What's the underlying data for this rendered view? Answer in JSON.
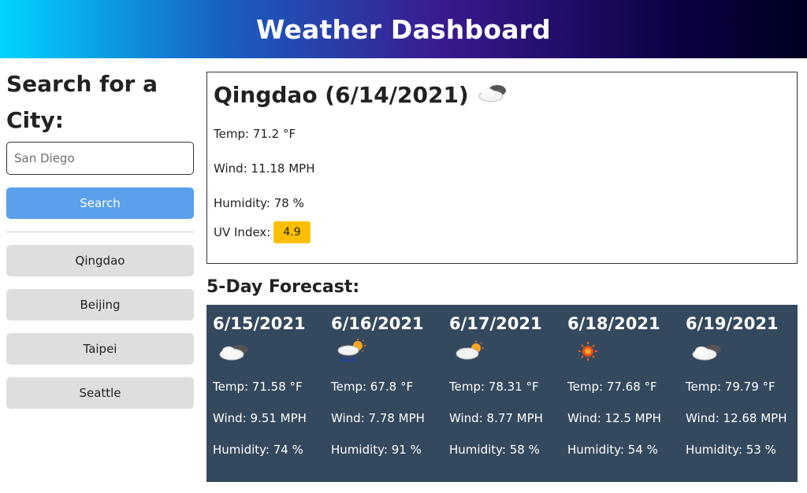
{
  "header": {
    "title": "Weather Dashboard"
  },
  "sidebar": {
    "heading": "Search for a City:",
    "search_placeholder": "San Diego",
    "search_button": "Search",
    "history": [
      "Qingdao",
      "Beijing",
      "Taipei",
      "Seattle"
    ]
  },
  "current": {
    "title": "Qingdao (6/14/2021)",
    "icon": "partly-cloudy-icon",
    "temp": "Temp: 71.2 °F",
    "wind": "Wind: 11.18 MPH",
    "humidity": "Humidity: 78 %",
    "uv_label": "UV Index:",
    "uv_value": "4.9",
    "uv_color": "#ffbf00"
  },
  "forecast": {
    "title": "5-Day Forecast:",
    "days": [
      {
        "date": "6/15/2021",
        "icon": "partly-cloudy-icon",
        "temp": "Temp: 71.58 °F",
        "wind": "Wind: 9.51 MPH",
        "humidity": "Humidity: 74 %"
      },
      {
        "date": "6/16/2021",
        "icon": "sun-rain-icon",
        "temp": "Temp: 67.8 °F",
        "wind": "Wind: 7.78 MPH",
        "humidity": "Humidity: 91 %"
      },
      {
        "date": "6/17/2021",
        "icon": "sun-cloud-icon",
        "temp": "Temp: 78.31 °F",
        "wind": "Wind: 8.77 MPH",
        "humidity": "Humidity: 58 %"
      },
      {
        "date": "6/18/2021",
        "icon": "sun-icon",
        "temp": "Temp: 77.68 °F",
        "wind": "Wind: 12.5 MPH",
        "humidity": "Humidity: 54 %"
      },
      {
        "date": "6/19/2021",
        "icon": "partly-cloudy-icon",
        "temp": "Temp: 79.79 °F",
        "wind": "Wind: 12.68 MPH",
        "humidity": "Humidity: 53 %"
      }
    ]
  },
  "colors": {
    "search_button": "#5aa0ea",
    "forecast_bg": "#34495e",
    "history_button": "#dedede"
  }
}
